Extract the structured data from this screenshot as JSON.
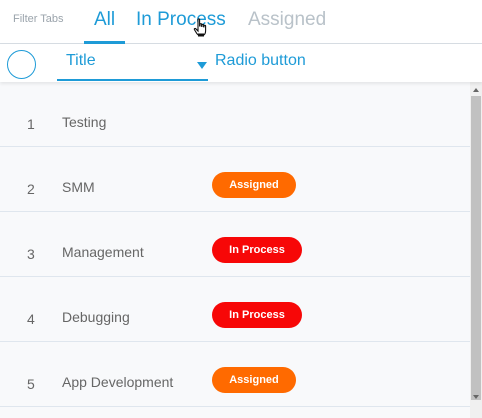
{
  "filter": {
    "label": "Filter Tabs",
    "tabs": [
      {
        "label": "All",
        "active": true
      },
      {
        "label": "In Process",
        "active": false
      },
      {
        "label": "Assigned",
        "active": false
      }
    ]
  },
  "header": {
    "title_column": "Title",
    "radio_column": "Radio button"
  },
  "rows": [
    {
      "num": "1",
      "title": "Testing",
      "status": ""
    },
    {
      "num": "2",
      "title": "SMM",
      "status": "Assigned"
    },
    {
      "num": "3",
      "title": "Management",
      "status": "In Process"
    },
    {
      "num": "4",
      "title": "Debugging",
      "status": "In Process"
    },
    {
      "num": "5",
      "title": "App Development",
      "status": "Assigned"
    }
  ],
  "colors": {
    "accent": "#1e9bd7",
    "assigned": "#ff6a00",
    "in_process": "#f70707",
    "inactive_tab": "#b9c2c9"
  },
  "icons": {
    "sort": "caret-down-icon",
    "cursor": "hand-pointer-icon",
    "select_all": "circle-checkbox-icon"
  }
}
